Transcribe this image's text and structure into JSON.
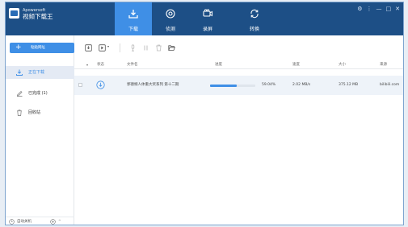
{
  "app": {
    "vendor": "Apowersoft",
    "name": "视频下载王"
  },
  "nav": {
    "tabs": [
      {
        "label": "下载",
        "active": true
      },
      {
        "label": "侦测",
        "active": false
      },
      {
        "label": "录屏",
        "active": false
      },
      {
        "label": "转换",
        "active": false
      }
    ]
  },
  "window_controls": [
    "⚙",
    "⋮",
    "—",
    "□",
    "✕"
  ],
  "sidebar": {
    "new_button": {
      "icon": "+",
      "label": "粘贴网址"
    },
    "items": [
      {
        "label": "正在下载",
        "icon": "download-icon",
        "active": true
      },
      {
        "label": "已完成 (1)",
        "icon": "edit-icon",
        "active": false
      },
      {
        "label": "回收站",
        "icon": "trash-icon",
        "active": false
      }
    ],
    "bottom": {
      "label": "自动关机",
      "icons": [
        "clock-icon",
        "plus-circle-icon"
      ],
      "caret": "^"
    }
  },
  "toolbar": {
    "icons": [
      "add-task-icon",
      "convert-icon",
      "microphone-icon",
      "pause-icon",
      "delete-icon",
      "folder-open-icon"
    ]
  },
  "table": {
    "columns": [
      "状态",
      "文件名",
      "进度",
      "速度",
      "大小",
      "来源"
    ],
    "sort_caret": "▾",
    "rows": [
      {
        "status_icon": "download-status-icon",
        "filename": "郭德纲人体重大奖系列 第十二期",
        "progress": 0.5904,
        "progress_text": "59.04%",
        "speed": "2.02 MB/s",
        "size": "375.12 MB",
        "source": "bilibili.com"
      }
    ]
  },
  "colors": {
    "titlebar": "#1d4f86",
    "accent": "#3f8fe6",
    "row_bg": "#eef3f9"
  }
}
